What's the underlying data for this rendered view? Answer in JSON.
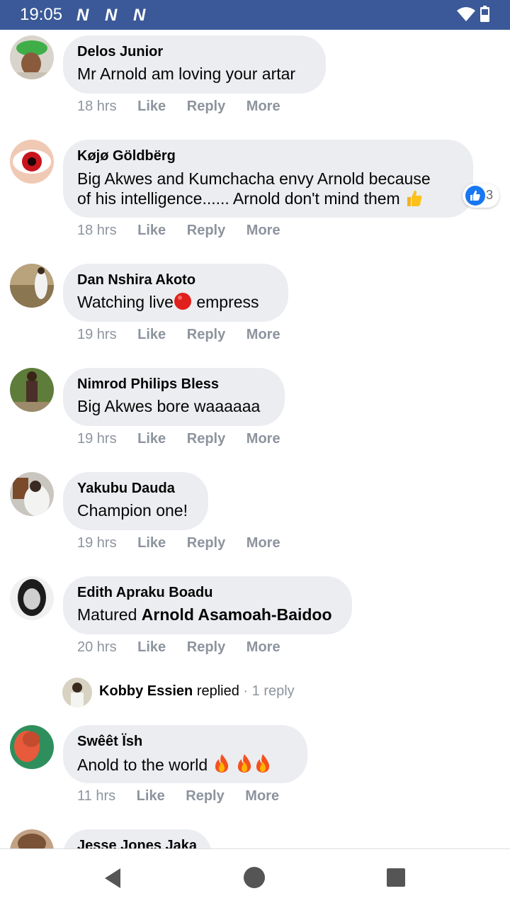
{
  "status_bar": {
    "time": "19:05",
    "notif_icons": [
      "N",
      "N",
      "N"
    ]
  },
  "comments": [
    {
      "name": "Delos Junior",
      "text": "Mr Arnold am loving your artar",
      "time": "18 hrs",
      "like": "Like",
      "reply": "Reply",
      "more": "More"
    },
    {
      "name": "Køjø Göldbërg",
      "text_line1": "Big Akwes and Kumchacha envy Arnold because",
      "text_line2": "of his intelligence...... Arnold don't mind them",
      "reaction_count": "3",
      "time": "18 hrs",
      "like": "Like",
      "reply": "Reply",
      "more": "More"
    },
    {
      "name": "Dan Nshira Akoto",
      "text_a": "Watching live",
      "text_b": " empress",
      "time": "19 hrs",
      "like": "Like",
      "reply": "Reply",
      "more": "More"
    },
    {
      "name": "Nimrod Philips Bless",
      "text": "Big Akwes bore waaaaaa",
      "time": "19 hrs",
      "like": "Like",
      "reply": "Reply",
      "more": "More"
    },
    {
      "name": "Yakubu Dauda",
      "text": "Champion one!",
      "time": "19 hrs",
      "like": "Like",
      "reply": "Reply",
      "more": "More"
    },
    {
      "name": "Edith Apraku Boadu",
      "text_prefix": "Matured ",
      "text_mention": "Arnold Asamoah-Baidoo",
      "time": "20 hrs",
      "like": "Like",
      "reply": "Reply",
      "more": "More",
      "replies": {
        "name": "Kobby Essien",
        "verb": " replied",
        "count": " · 1 reply"
      }
    },
    {
      "name": "Swêêt Ïsh",
      "text": "Anold to the world",
      "time": "11 hrs",
      "like": "Like",
      "reply": "Reply",
      "more": "More"
    },
    {
      "name": "Jesse Jones Jaka"
    }
  ],
  "colors": {
    "status_bar": "#3b5998",
    "bubble": "#ebedf0",
    "meta": "#8d949e",
    "like_blue": "#1877f2"
  }
}
